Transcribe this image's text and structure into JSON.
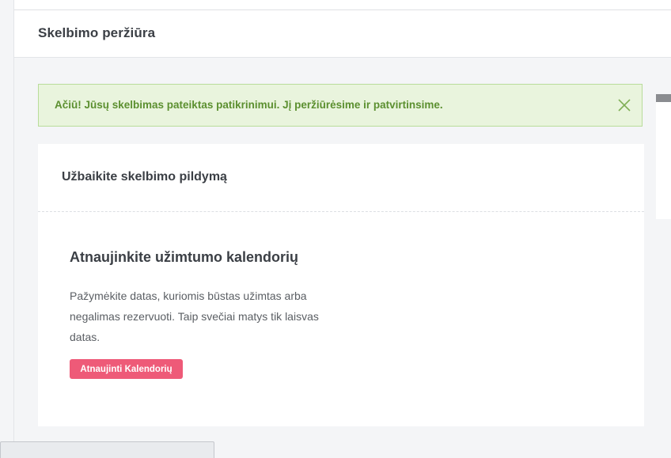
{
  "header": {
    "title": "Skelbimo peržiūra"
  },
  "alert": {
    "message": "Ačiū! Jūsų skelbimas pateiktas patikrinimui. Jį peržiūrėsime ir patvirtinsime.",
    "close_icon": "close-icon"
  },
  "card": {
    "header_title": "Užbaikite skelbimo pildymą",
    "section": {
      "title": "Atnaujinkite užimtumo kalendorių",
      "description": "Pažymėkite datas, kuriomis būstas užimtas arba negalimas rezervuoti. Taip svečiai matys tik laisvas datas.",
      "button_label": "Atnaujinti Kalendorių"
    }
  },
  "colors": {
    "alert_background": "#e9f4dd",
    "alert_border": "#b9dc9a",
    "alert_text": "#5b8f2f",
    "primary_button": "#ee5a78"
  }
}
